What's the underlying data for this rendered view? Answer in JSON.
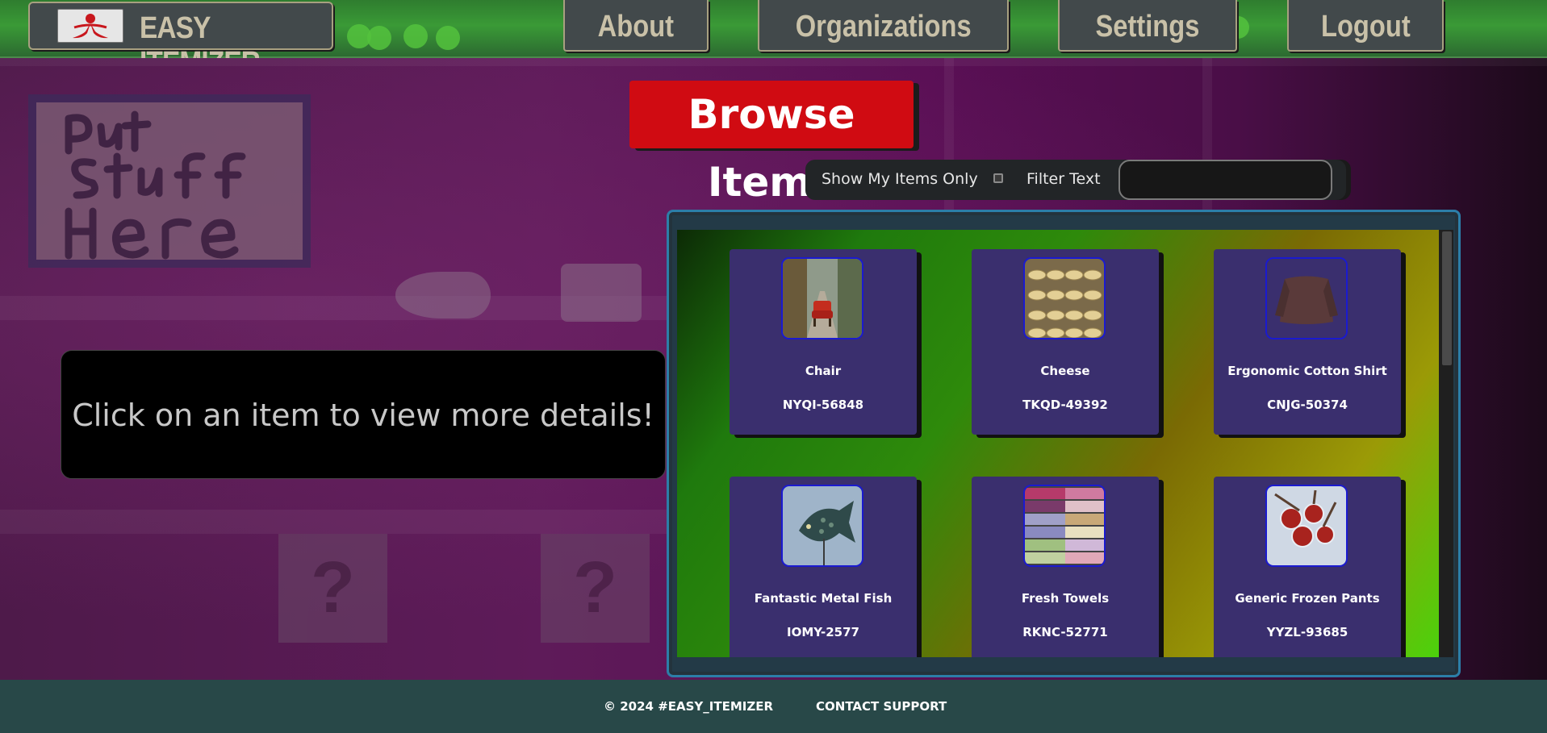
{
  "brand": {
    "title": "EASY ITEMIZER"
  },
  "nav": {
    "about": "About",
    "organizations": "Organizations",
    "settings": "Settings",
    "logout": "Logout"
  },
  "page": {
    "title": "Browse Items"
  },
  "filter": {
    "show_mine_label": "Show My Items Only",
    "show_mine_checked": false,
    "filter_text_label": "Filter Text",
    "filter_value": ""
  },
  "info": {
    "message": "Click on an item to view more details!"
  },
  "items": [
    {
      "name": "Chair",
      "code": "NYQI-56848",
      "image": "chair-photo"
    },
    {
      "name": "Cheese",
      "code": "TKQD-49392",
      "image": "cheese-photo"
    },
    {
      "name": "Ergonomic Cotton Shirt",
      "code": "CNJG-50374",
      "image": "shirt-photo"
    },
    {
      "name": "Fantastic Metal Fish",
      "code": "IOMY-2577",
      "image": "fish-photo"
    },
    {
      "name": "Fresh Towels",
      "code": "RKNC-52771",
      "image": "towels-photo"
    },
    {
      "name": "Generic Frozen Pants",
      "code": "YYZL-93685",
      "image": "frozen-fruit-photo"
    }
  ],
  "footer": {
    "copyright": "© 2024 #EASY_ITEMIZER",
    "support": "CONTACT SUPPORT"
  },
  "background_sign": {
    "lettering": "Put Stuff Here"
  },
  "colors": {
    "header_green": "#3a9a36",
    "title_red": "#d00b12",
    "card_purple": "#3a2f6e",
    "footer": "#284848"
  }
}
